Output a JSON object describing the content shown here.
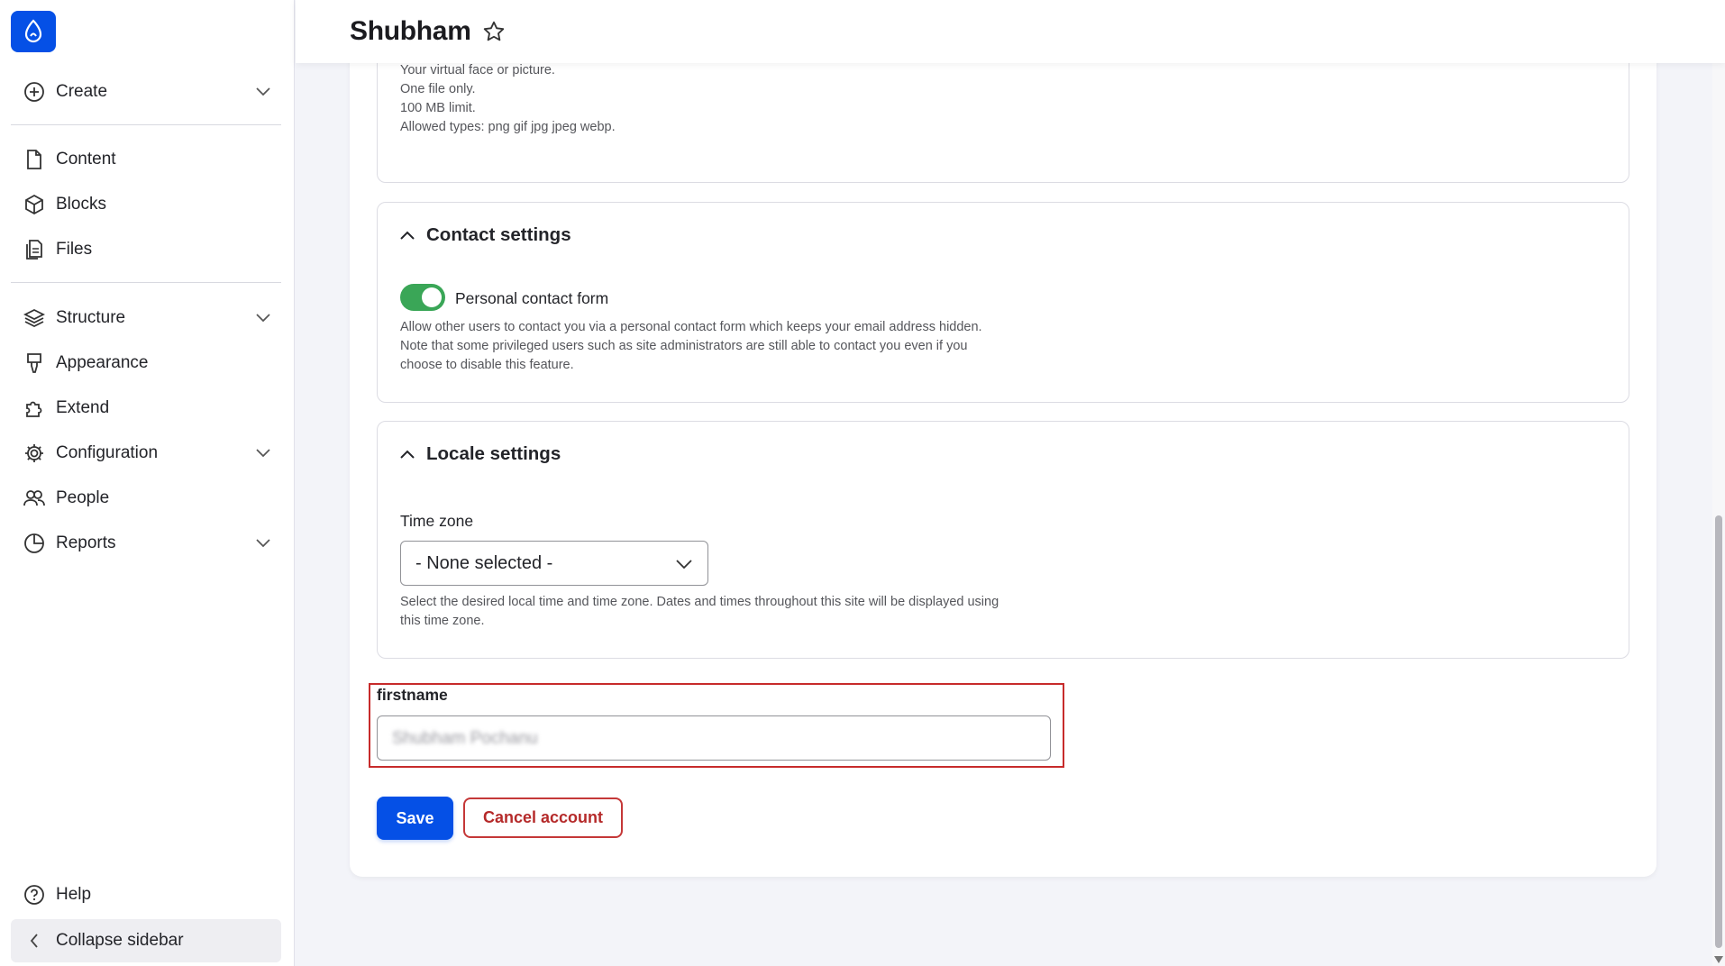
{
  "sidebar": {
    "items": [
      {
        "label": "Create",
        "icon": "plus-circle-icon"
      },
      {
        "label": "Content",
        "icon": "document-icon"
      },
      {
        "label": "Blocks",
        "icon": "cube-icon"
      },
      {
        "label": "Files",
        "icon": "files-icon"
      },
      {
        "label": "Structure",
        "icon": "layers-icon"
      },
      {
        "label": "Appearance",
        "icon": "brush-icon"
      },
      {
        "label": "Extend",
        "icon": "puzzle-icon"
      },
      {
        "label": "Configuration",
        "icon": "gear-icon"
      },
      {
        "label": "People",
        "icon": "people-icon"
      },
      {
        "label": "Reports",
        "icon": "pie-chart-icon"
      }
    ],
    "help_label": "Help",
    "collapse_label": "Collapse sidebar"
  },
  "header": {
    "title": "Shubham"
  },
  "picture": {
    "help_lines": [
      "Your virtual face or picture.",
      "One file only.",
      "100 MB limit.",
      "Allowed types: png gif jpg jpeg webp."
    ]
  },
  "contact": {
    "title": "Contact settings",
    "toggle_label": "Personal contact form",
    "toggle_on": true,
    "help_lines": [
      "Allow other users to contact you via a personal contact form which keeps your email address hidden.",
      "Note that some privileged users such as site administrators are still able to contact you even if you",
      "choose to disable this feature."
    ]
  },
  "locale": {
    "title": "Locale settings",
    "timezone_label": "Time zone",
    "timezone_value": "- None selected -",
    "help_lines": [
      "Select the desired local time and time zone. Dates and times throughout this site will be displayed using",
      "this time zone."
    ]
  },
  "firstname": {
    "label": "firstname",
    "value": "Shubham Pochanu"
  },
  "actions": {
    "save_label": "Save",
    "cancel_label": "Cancel account"
  },
  "colors": {
    "primary": "#0550e6",
    "danger": "#c53838",
    "toggle_on": "#3aa657",
    "highlight": "#c72b2b"
  }
}
